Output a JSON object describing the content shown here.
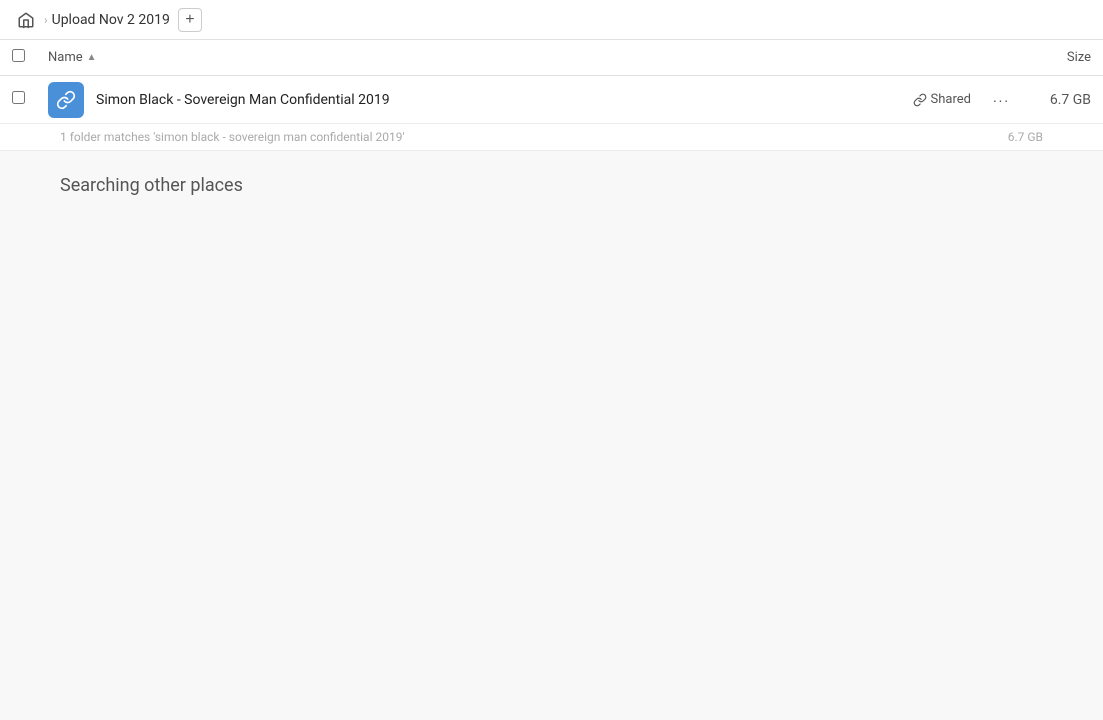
{
  "header": {
    "home_label": "🏠",
    "breadcrumb_title": "Upload Nov 2 2019",
    "add_button_label": "+"
  },
  "columns": {
    "name_label": "Name",
    "sort_indicator": "▲",
    "size_label": "Size"
  },
  "file_result": {
    "icon_color": "#4a90d9",
    "name": "Simon Black - Sovereign Man Confidential 2019",
    "shared_label": "Shared",
    "more_label": "···",
    "size": "6.7 GB"
  },
  "match_info": {
    "text": "1 folder matches 'simon black - sovereign man confidential 2019'",
    "size": "6.7 GB"
  },
  "searching": {
    "label": "Searching other places"
  }
}
